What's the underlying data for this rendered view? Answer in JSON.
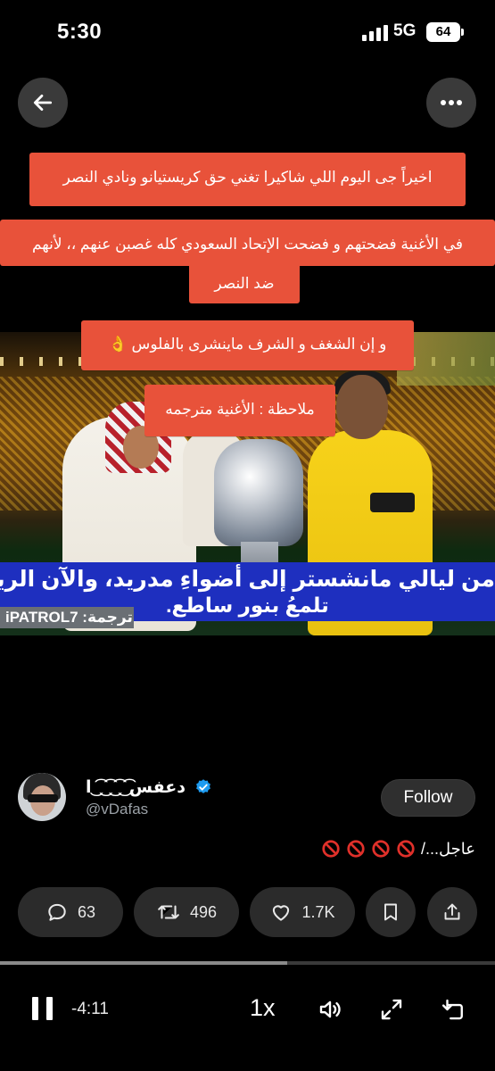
{
  "status_bar": {
    "time": "5:30",
    "network": "5G",
    "battery": "64"
  },
  "overlays": {
    "line1": "اخيراً جى اليوم اللي شاكيرا تغني حق كريستيانو ونادي النصر",
    "line2a": "في الأغنية فضحتهم و فضحت الإتحاد السعودي كله غصبن عنهم ،، لأنهم",
    "line2b": "ضد النصر",
    "line3": "و إن الشغف و الشرف ماينشرى بالفلوس 👌",
    "line4": "ملاحظة : الأغنية مترجمه"
  },
  "video": {
    "subtitle_line1": "من ليالي مانشستر إلى أضواءِ مدريد، والآن الرياض",
    "subtitle_line2": "تلمعُ بنور ساطع.",
    "credit": "iPATROL7 :ترجمة"
  },
  "author": {
    "name": "دعفس ͡ ͜ ͡ ͜ ͡ ͜ ͡ ͜ا",
    "handle": "@vDafas",
    "follow_label": "Follow"
  },
  "caption": "عاجل.../",
  "actions": {
    "replies": "63",
    "retweets": "496",
    "likes": "1.7K"
  },
  "player": {
    "remaining": "-4:11",
    "speed": "1x",
    "progress": 0.58
  },
  "colors": {
    "callout": "#e8523a",
    "subtitle_band": "#1e2fbf",
    "verified": "#1d9bf0"
  }
}
